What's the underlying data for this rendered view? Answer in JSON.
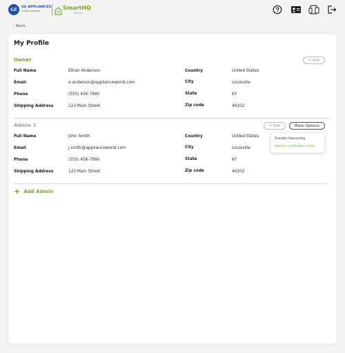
{
  "header": {
    "ge_logo_text": "GE",
    "brand_name": "GE APPLIANCES",
    "brand_sub": "a Haier company",
    "smarthq_name": "SmartHQ",
    "smarthq_sub": "SERVICE",
    "icons": [
      "help-icon",
      "contact-card-icon",
      "devices-icon",
      "logout-icon"
    ]
  },
  "nav": {
    "back_label": "Back"
  },
  "page": {
    "title": "My Profile"
  },
  "owner": {
    "section_label": "Owner",
    "edit_label": "Edit",
    "fields_left": [
      {
        "label": "Full Name",
        "value": "Ethan Anderson"
      },
      {
        "label": "Email",
        "value": "e.anderson@applianceworld.com"
      },
      {
        "label": "Phone",
        "value": "(555) 456-7890"
      },
      {
        "label": "Shipping Address",
        "value": "123 Main Street"
      }
    ],
    "fields_right": [
      {
        "label": "Country",
        "value": "United States"
      },
      {
        "label": "City",
        "value": "Louisville"
      },
      {
        "label": "State",
        "value": "KY"
      },
      {
        "label": "Zip code",
        "value": "40202"
      }
    ]
  },
  "admin1": {
    "section_label": "Admin 1",
    "edit_label": "Edit",
    "more_options_label": "More Options",
    "menu": [
      "Transfer Ownership",
      "Resend verification email"
    ],
    "fields_left": [
      {
        "label": "Full Name",
        "value": "John Smith"
      },
      {
        "label": "Email",
        "value": "j.smith@applianceworld.com"
      },
      {
        "label": "Phone",
        "value": "(555) 456-7890"
      },
      {
        "label": "Shipping Address",
        "value": "123 Main Street"
      }
    ],
    "fields_right": [
      {
        "label": "Country",
        "value": "United States"
      },
      {
        "label": "City",
        "value": "Louisville"
      },
      {
        "label": "State",
        "value": "KY"
      },
      {
        "label": "Zip code",
        "value": "40202"
      }
    ]
  },
  "actions": {
    "add_admin_label": "Add Admin"
  },
  "colors": {
    "accent_green": "#74a725",
    "ge_blue": "#1e4fa2",
    "muted_gray": "#9a9a9a"
  }
}
